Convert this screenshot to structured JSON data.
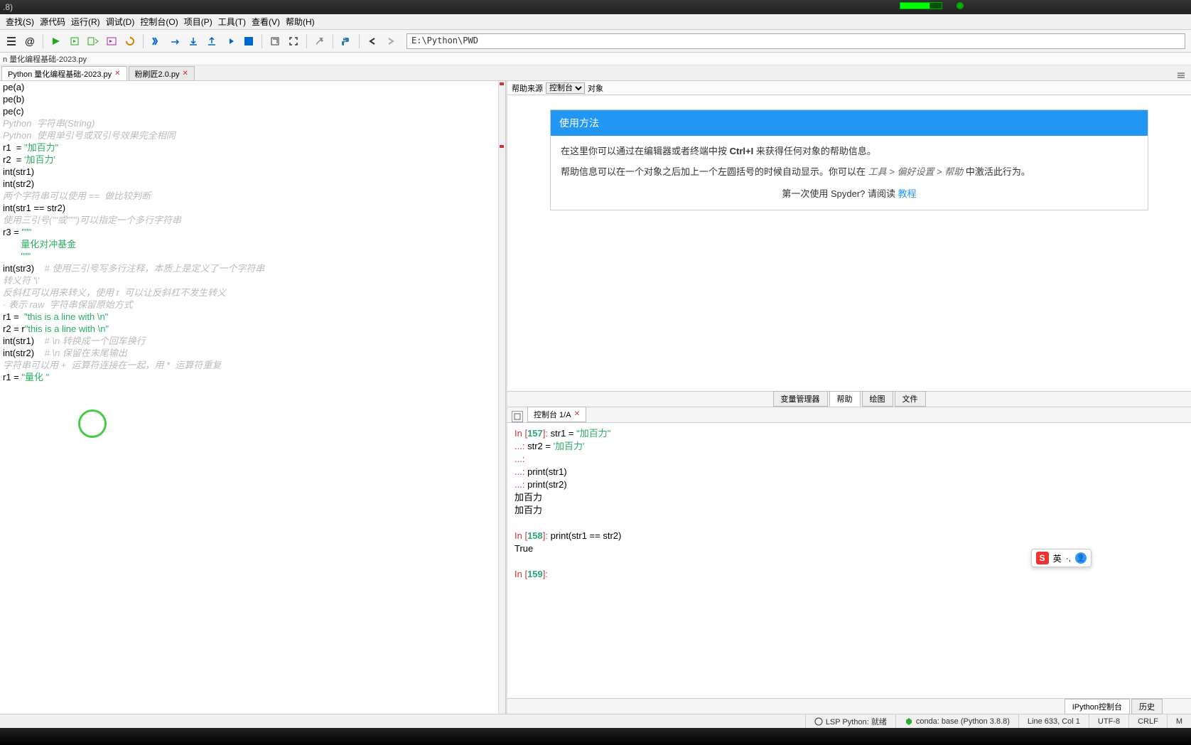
{
  "title_suffix": ".8)",
  "menu": [
    "查找(S)",
    "源代码",
    "运行(R)",
    "调试(D)",
    "控制台(O)",
    "项目(P)",
    "工具(T)",
    "查看(V)",
    "帮助(H)"
  ],
  "path": "E:\\Python\\PWD",
  "breadcrumb": "n 量化编程基础-2023.py",
  "tabs": [
    {
      "label": "Python 量化编程基础-2023.py",
      "active": true
    },
    {
      "label": "粉刷匠2.0.py",
      "active": false
    }
  ],
  "code": [
    {
      "text": "pe(a)"
    },
    {
      "text": "pe(b)"
    },
    {
      "text": "pe(c)"
    },
    {
      "text": ""
    },
    {
      "text": ""
    },
    {
      "text": ""
    },
    {
      "text": ""
    },
    {
      "text": "Python  字符串(String)",
      "cls": "py-cmt"
    },
    {
      "text": "Python  使用单引号或双引号效果完全相同",
      "cls": "py-cmt"
    },
    {
      "html": "r1  = <span class='py-str'>\"加百力\"</span>"
    },
    {
      "html": "r2  = <span class='py-str'>'加百力'</span>"
    },
    {
      "text": ""
    },
    {
      "text": "int(str1)"
    },
    {
      "text": "int(str2)"
    },
    {
      "text": ""
    },
    {
      "text": ""
    },
    {
      "text": ""
    },
    {
      "text": "两个字符串可以使用 ==  做比较判断",
      "cls": "py-cmt"
    },
    {
      "text": "int(str1 == str2)"
    },
    {
      "text": "",
      "hl": true
    },
    {
      "text": ""
    },
    {
      "text": ""
    },
    {
      "text": "使用三引号('''或\"\"\")可以指定一个多行字符串",
      "cls": "py-cmt"
    },
    {
      "html": "r3 = <span class='py-str'>\"\"\"</span>"
    },
    {
      "html": "       <span class='py-str'>量化对冲基金</span>"
    },
    {
      "html": "       <span class='py-str'>\"\"\"</span>"
    },
    {
      "html": "int(str3)    <span class='py-cmt'># 使用三引号写多行注释，本质上是定义了一个字符串</span>"
    },
    {
      "text": ""
    },
    {
      "text": ""
    },
    {
      "text": ""
    },
    {
      "text": "转义符 '\\'",
      "cls": "py-cmt"
    },
    {
      "text": "反斜杠可以用来转义，使用 r  可以让反斜杠不发生转义",
      "cls": "py-cmt"
    },
    {
      "text": "· 表示 raw  字符串保留原始方式",
      "cls": "py-cmt"
    },
    {
      "html": "r1 =  <span class='py-str'>\"this is a line with \\n\"</span>"
    },
    {
      "html": "r2 = r<span class='py-str'>\"this is a line with \\n\"</span>"
    },
    {
      "html": "int(str1)    <span class='py-cmt'># \\n 转换成一个回车换行</span>"
    },
    {
      "html": "int(str2)    <span class='py-cmt'># \\n 保留在末尾输出</span>"
    },
    {
      "text": ""
    },
    {
      "text": ""
    },
    {
      "text": ""
    },
    {
      "text": "字符串可以用 +  运算符连接在一起，用 *  运算符重复",
      "cls": "py-cmt"
    },
    {
      "html": "r1 = <span class='py-str'>\"量化 \"</span>"
    }
  ],
  "help": {
    "source_label": "帮助来源",
    "source_value": "控制台",
    "object_label": "对象",
    "title": "使用方法",
    "p1a": "在这里你可以通过在编辑器或者终端中按 ",
    "p1b": "Ctrl+I",
    "p1c": " 来获得任何对象的帮助信息。",
    "p2a": "帮助信息可以在一个对象之后加上一个左圆括号的时候自动显示。你可以在 ",
    "p2b": "工具 > 偏好设置 > 帮助",
    "p2c": " 中激活此行为。",
    "p3a": "第一次使用 Spyder? 请阅读 ",
    "p3b": "教程"
  },
  "right_tabs": [
    "变量管理器",
    "帮助",
    "绘图",
    "文件"
  ],
  "console_tab": "控制台 1/A",
  "console": {
    "in157": "157",
    "in158": "158",
    "in159": "159",
    "l1": "str1 = ",
    "l1s": "\"加百力\"",
    "l2": "str2 = ",
    "l2s": "'加百力'",
    "l3": "print(str1)",
    "l4": "print(str2)",
    "out1": "加百力",
    "out2": "加百力",
    "l5": "print(str1 == str2)",
    "out3": "True"
  },
  "bottom_tabs": [
    "IPython控制台",
    "历史"
  ],
  "status": {
    "lsp": "LSP Python: 就绪",
    "conda": "conda: base (Python 3.8.8)",
    "pos": "Line 633, Col 1",
    "enc": "UTF-8",
    "eol": "CRLF",
    "mem": "M"
  },
  "ime": {
    "s": "S",
    "lang": "英",
    "sep": "·,"
  }
}
